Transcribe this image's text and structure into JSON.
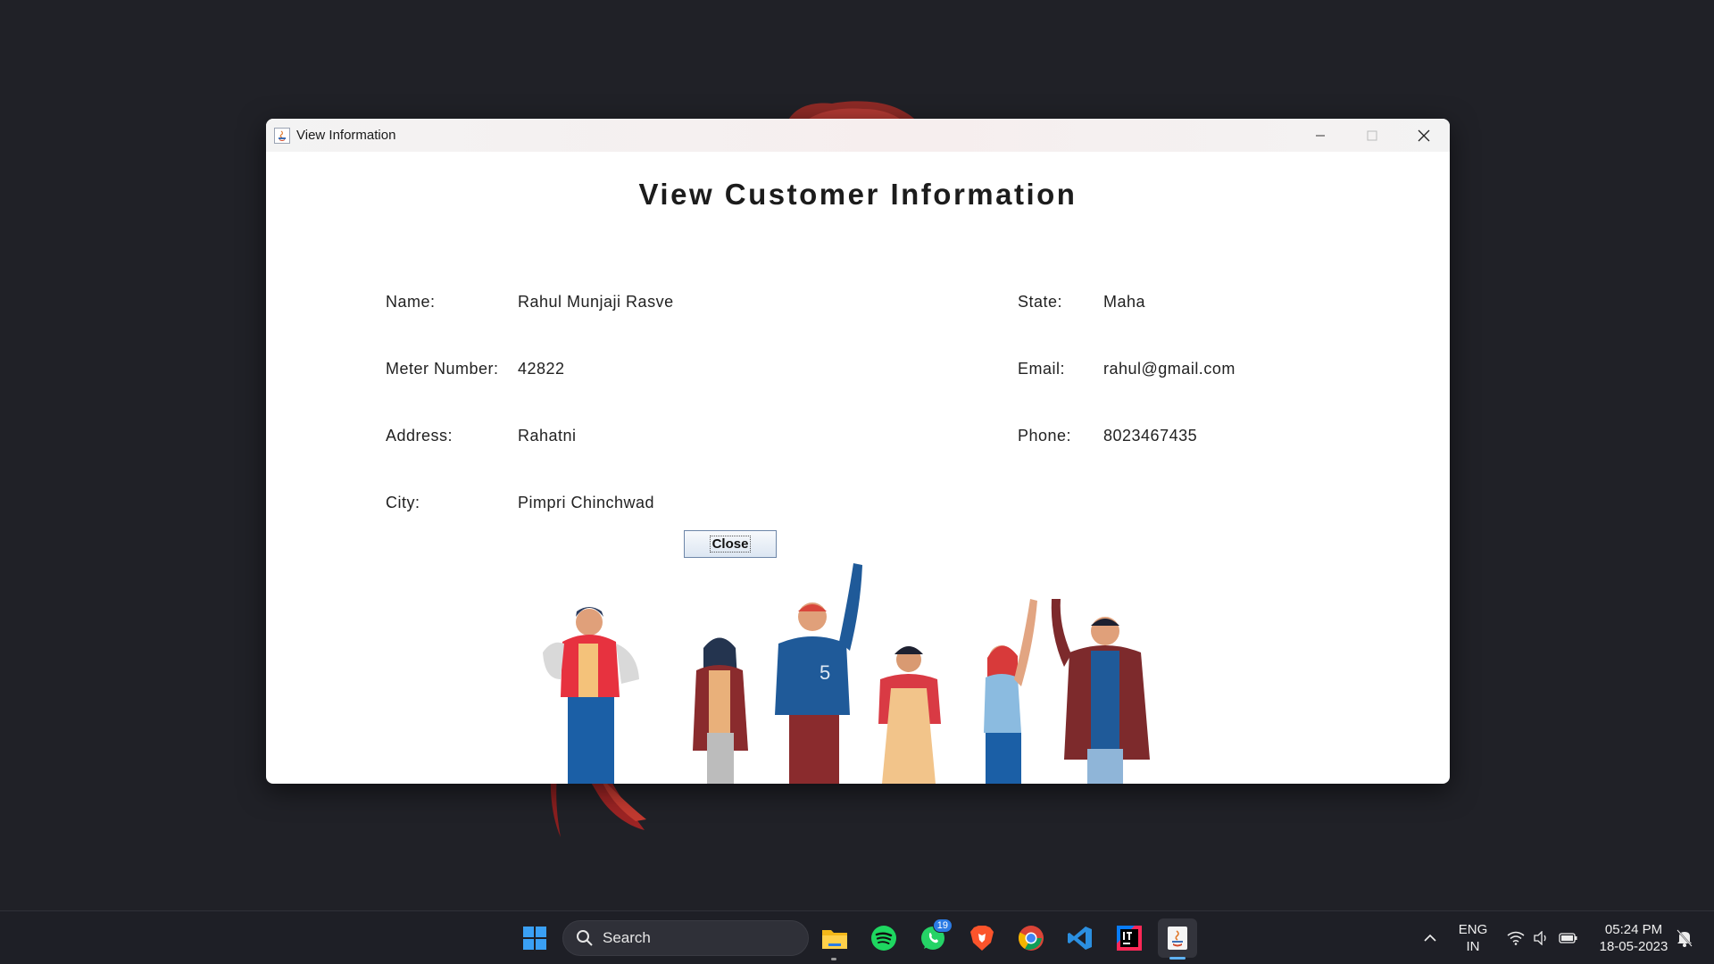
{
  "window": {
    "title": "View Information",
    "heading": "View Customer Information",
    "close_button_label": "Close"
  },
  "fields": {
    "name_label": "Name:",
    "name_value": "Rahul Munjaji Rasve",
    "meter_label": "Meter Number:",
    "meter_value": "42822",
    "address_label": "Address:",
    "address_value": "Rahatni",
    "city_label": "City:",
    "city_value": "Pimpri Chinchwad",
    "state_label": "State:",
    "state_value": "Maha",
    "email_label": "Email:",
    "email_value": "rahul@gmail.com",
    "phone_label": "Phone:",
    "phone_value": "8023467435"
  },
  "taskbar": {
    "search_label": "Search",
    "whatsapp_badge": "19",
    "language_line1": "ENG",
    "language_line2": "IN",
    "time": "05:24 PM",
    "date": "18-05-2023",
    "icons": [
      "windows-start-icon",
      "search-icon",
      "file-explorer-icon",
      "spotify-icon",
      "whatsapp-icon",
      "brave-icon",
      "chrome-icon",
      "vscode-icon",
      "intellij-icon",
      "java-app-icon",
      "chevron-up-icon",
      "wifi-icon",
      "volume-icon",
      "battery-icon",
      "notification-icon"
    ]
  },
  "colors": {
    "desktop": "#202127",
    "window_bg": "#ffffff",
    "taskbar": "#1e1f26",
    "accent": "#2b7be4"
  }
}
